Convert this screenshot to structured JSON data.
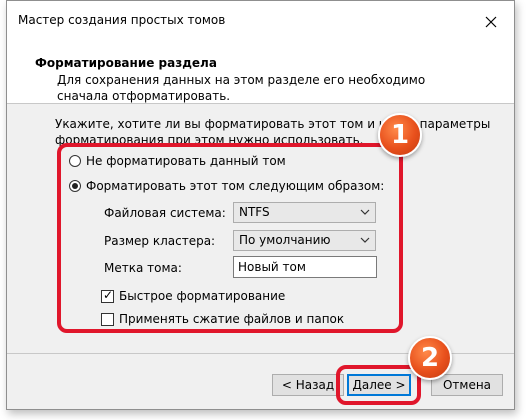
{
  "window": {
    "title": "Мастер создания простых томов"
  },
  "header": {
    "title": "Форматирование раздела",
    "subtitle": "Для сохранения данных на этом разделе его необходимо сначала отформатировать."
  },
  "intro_text": "Укажите, хотите ли вы форматировать этот том и какие параметры форматирования при этом нужно использовать.",
  "options": {
    "no_format_label": "Не форматировать данный том",
    "format_label": "Форматировать этот том следующим образом:",
    "selected": "format"
  },
  "fields": {
    "filesystem_label": "Файловая система:",
    "filesystem_value": "NTFS",
    "cluster_label": "Размер кластера:",
    "cluster_value": "По умолчанию",
    "volume_label_label": "Метка тома:",
    "volume_label_value": "Новый том"
  },
  "checkboxes": {
    "quick_format_label": "Быстрое форматирование",
    "quick_format_checked": true,
    "compression_label": "Применять сжатие файлов и папок",
    "compression_checked": false
  },
  "buttons": {
    "back": "< Назад",
    "next": "Далее >",
    "cancel": "Отмена"
  },
  "annotations": {
    "badge1": "1",
    "badge2": "2",
    "highlight_color": "#e0162b",
    "badge_color": "#e8501c"
  },
  "colors": {
    "focus_blue": "#0078d7"
  }
}
